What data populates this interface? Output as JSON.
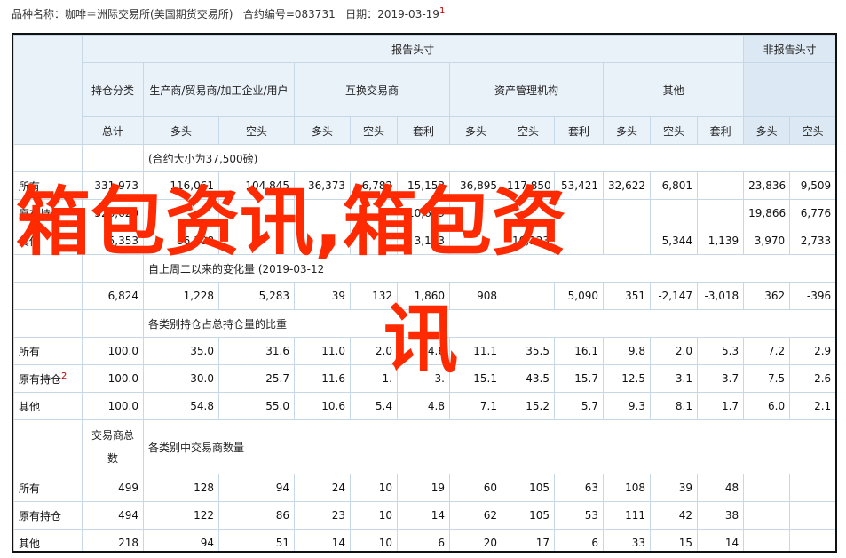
{
  "header": {
    "prefix": "品种名称：",
    "name": "咖啡＝洲际交易所(美国期货交易所)",
    "code_label": "合约编号=",
    "code": "083731",
    "date_label": "日期：",
    "date": "2019-03-19",
    "mark": "1"
  },
  "table": {
    "report_head": "报告头寸",
    "nonreport_head": "非报告头寸",
    "col_holding_class": "持仓分类",
    "groups": {
      "producer": "生产商/贸易商/加工企业/用户",
      "swap": "互换交易商",
      "managed": "资产管理机构",
      "other": "其他"
    },
    "sub": {
      "total": "总计",
      "long": "多头",
      "short": "空头",
      "spread": "套利"
    },
    "section1": "(合约大小为37,500磅)",
    "rows1": [
      {
        "label": "所有",
        "vals": [
          "331,973",
          "116,061",
          "104,845",
          "36,373",
          "6,782",
          "15,153",
          "36,895",
          "117,850",
          "53,421",
          "32,622",
          "6,801",
          "23,836",
          "9,509"
        ]
      },
      {
        "label": "原有持仓",
        "vals": [
          "326,620",
          "",
          "",
          "",
          "",
          "10,619",
          "",
          "",
          "",
          "",
          "",
          "19,866",
          "6,776"
        ]
      },
      {
        "label": "其他",
        "vals": [
          "5,353",
          "86,308",
          "",
          "",
          "",
          "3,173",
          "",
          "10,123",
          "",
          "",
          "5,344",
          "3,970",
          "2,733"
        ]
      }
    ],
    "extra_vals": [
      "",
      "",
      "",
      "",
      "",
      "",
      "",
      "",
      "",
      "",
      "1,139",
      "",
      ""
    ],
    "section2": "自上周二以来的变化量 (2019-03-12",
    "change_row": [
      "6,824",
      "1,228",
      "5,283",
      "39",
      "132",
      "1,860",
      "908",
      "",
      "5,090",
      "351",
      "-2,147",
      "-3,018",
      "362",
      "-396"
    ],
    "section3": "各类别持仓占总持仓量的比重",
    "rows3": [
      {
        "label": "所有",
        "vals": [
          "100.0",
          "35.0",
          "31.6",
          "11.0",
          "2.0",
          "4.6",
          "11.1",
          "35.5",
          "16.1",
          "9.8",
          "2.0",
          "5.3",
          "7.2",
          "2.9"
        ]
      },
      {
        "label": "原有持仓",
        "mark": "2",
        "vals": [
          "100.0",
          "30.0",
          "25.7",
          "11.6",
          "1.",
          "3.",
          "15.1",
          "43.5",
          "15.7",
          "12.5",
          "3.1",
          "3.7",
          "7.5",
          "2.6"
        ]
      },
      {
        "label": "其他",
        "vals": [
          "100.0",
          "54.8",
          "55.0",
          "10.6",
          "5.4",
          "4.8",
          "7.1",
          "15.2",
          "5.7",
          "9.3",
          "8.1",
          "1.7",
          "6.0",
          "2.1"
        ]
      }
    ],
    "trader_label": "交易商总数",
    "section4": "各类别中交易商数量",
    "rows4": [
      {
        "label": "所有",
        "vals": [
          "499",
          "128",
          "94",
          "24",
          "10",
          "19",
          "60",
          "105",
          "63",
          "108",
          "39",
          "48",
          "",
          ""
        ]
      },
      {
        "label": "原有持仓",
        "vals": [
          "494",
          "122",
          "86",
          "23",
          "10",
          "14",
          "62",
          "105",
          "53",
          "111",
          "42",
          "38",
          "",
          ""
        ]
      },
      {
        "label": "其他",
        "vals": [
          "218",
          "94",
          "51",
          "14",
          "10",
          "6",
          "20",
          "17",
          "6",
          "33",
          "15",
          "14",
          "",
          ""
        ]
      }
    ]
  },
  "watermark": {
    "line1": "箱包资讯,箱包资",
    "line2": "讯"
  },
  "colors": {
    "watermark": "#ff2a00",
    "header_bg": "#e9f1f9",
    "border": "#c6d7e8"
  }
}
